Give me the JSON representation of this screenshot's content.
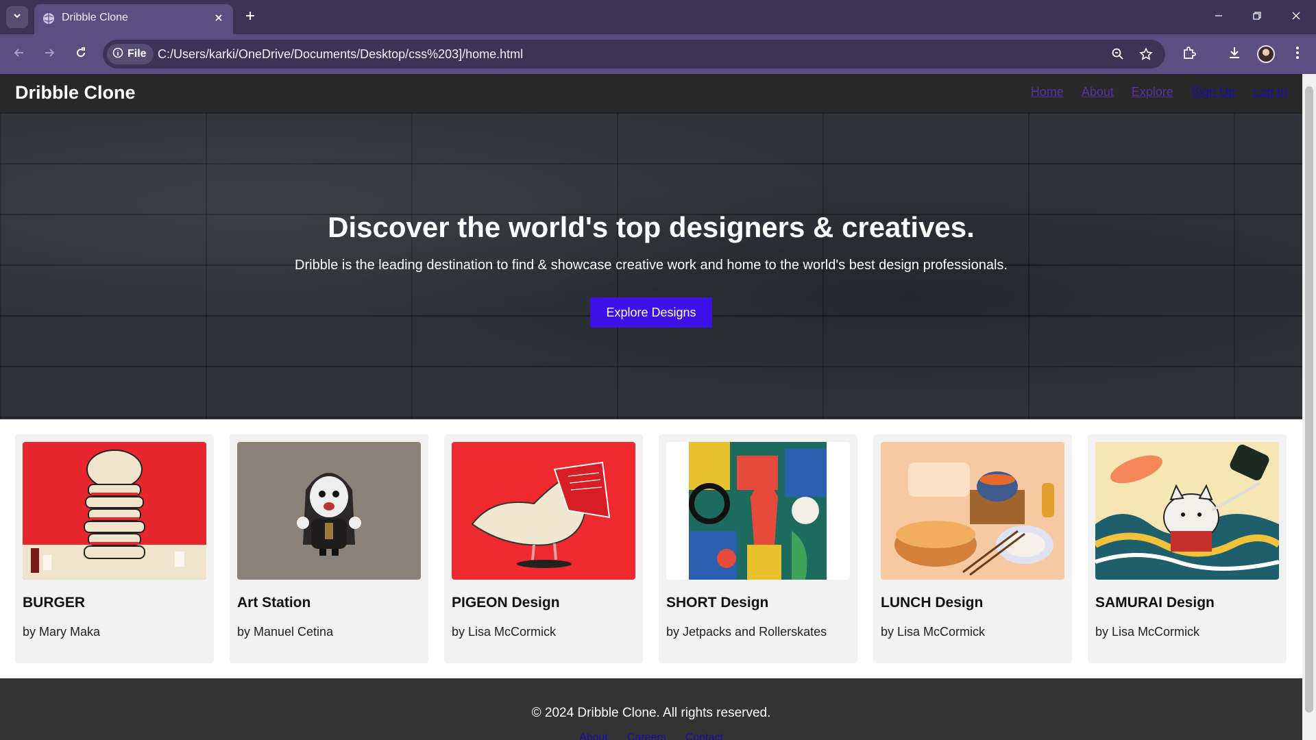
{
  "browser": {
    "tab_title": "Dribble Clone",
    "file_chip": "File",
    "url": "C:/Users/karki/OneDrive/Documents/Desktop/css%203]/home.html"
  },
  "site": {
    "logo": "Dribble Clone",
    "nav": [
      "Home",
      "About",
      "Explore",
      "Sign Up",
      "Log In"
    ]
  },
  "hero": {
    "title": "Discover the world's top designers & creatives.",
    "subtitle": "Dribble is the leading destination to find & showcase creative work and home to the world's best design professionals.",
    "button": "Explore Designs"
  },
  "cards": [
    {
      "title": "BURGER",
      "author": "by Mary Maka"
    },
    {
      "title": "Art Station",
      "author": "by Manuel Cetina"
    },
    {
      "title": "PIGEON Design",
      "author": "by Lisa McCormick"
    },
    {
      "title": "SHORT Design",
      "author": "by Jetpacks and Rollerskates"
    },
    {
      "title": "LUNCH Design",
      "author": "by Lisa McCormick"
    },
    {
      "title": "SAMURAI Design",
      "author": "by Lisa McCormick"
    }
  ],
  "footer": {
    "copyright": "© 2024 Dribble Clone. All rights reserved.",
    "links": [
      "About",
      "Careers",
      "Contact"
    ]
  },
  "colors": {
    "tabbar": "#3c3457",
    "toolbar": "#5b4f82",
    "header": "#282828",
    "hero_button": "#3d10e8",
    "footer": "#333333",
    "card": "#f2f2f2"
  }
}
